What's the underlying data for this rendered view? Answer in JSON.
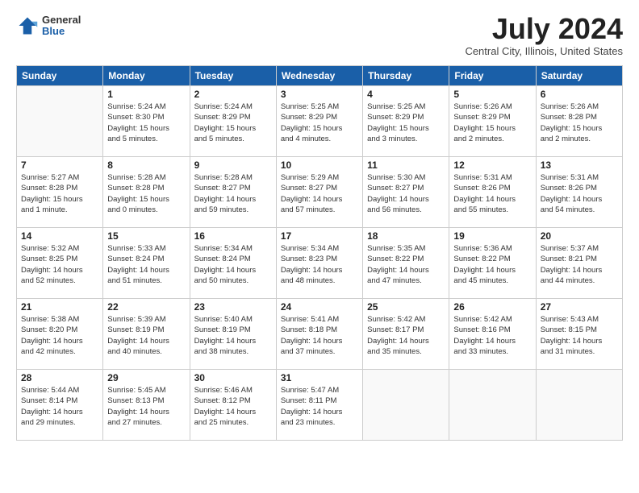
{
  "logo": {
    "general": "General",
    "blue": "Blue"
  },
  "title": "July 2024",
  "location": "Central City, Illinois, United States",
  "headers": [
    "Sunday",
    "Monday",
    "Tuesday",
    "Wednesday",
    "Thursday",
    "Friday",
    "Saturday"
  ],
  "weeks": [
    [
      {
        "day": "",
        "info": ""
      },
      {
        "day": "1",
        "info": "Sunrise: 5:24 AM\nSunset: 8:30 PM\nDaylight: 15 hours\nand 5 minutes."
      },
      {
        "day": "2",
        "info": "Sunrise: 5:24 AM\nSunset: 8:29 PM\nDaylight: 15 hours\nand 5 minutes."
      },
      {
        "day": "3",
        "info": "Sunrise: 5:25 AM\nSunset: 8:29 PM\nDaylight: 15 hours\nand 4 minutes."
      },
      {
        "day": "4",
        "info": "Sunrise: 5:25 AM\nSunset: 8:29 PM\nDaylight: 15 hours\nand 3 minutes."
      },
      {
        "day": "5",
        "info": "Sunrise: 5:26 AM\nSunset: 8:29 PM\nDaylight: 15 hours\nand 2 minutes."
      },
      {
        "day": "6",
        "info": "Sunrise: 5:26 AM\nSunset: 8:28 PM\nDaylight: 15 hours\nand 2 minutes."
      }
    ],
    [
      {
        "day": "7",
        "info": "Sunrise: 5:27 AM\nSunset: 8:28 PM\nDaylight: 15 hours\nand 1 minute."
      },
      {
        "day": "8",
        "info": "Sunrise: 5:28 AM\nSunset: 8:28 PM\nDaylight: 15 hours\nand 0 minutes."
      },
      {
        "day": "9",
        "info": "Sunrise: 5:28 AM\nSunset: 8:27 PM\nDaylight: 14 hours\nand 59 minutes."
      },
      {
        "day": "10",
        "info": "Sunrise: 5:29 AM\nSunset: 8:27 PM\nDaylight: 14 hours\nand 57 minutes."
      },
      {
        "day": "11",
        "info": "Sunrise: 5:30 AM\nSunset: 8:27 PM\nDaylight: 14 hours\nand 56 minutes."
      },
      {
        "day": "12",
        "info": "Sunrise: 5:31 AM\nSunset: 8:26 PM\nDaylight: 14 hours\nand 55 minutes."
      },
      {
        "day": "13",
        "info": "Sunrise: 5:31 AM\nSunset: 8:26 PM\nDaylight: 14 hours\nand 54 minutes."
      }
    ],
    [
      {
        "day": "14",
        "info": "Sunrise: 5:32 AM\nSunset: 8:25 PM\nDaylight: 14 hours\nand 52 minutes."
      },
      {
        "day": "15",
        "info": "Sunrise: 5:33 AM\nSunset: 8:24 PM\nDaylight: 14 hours\nand 51 minutes."
      },
      {
        "day": "16",
        "info": "Sunrise: 5:34 AM\nSunset: 8:24 PM\nDaylight: 14 hours\nand 50 minutes."
      },
      {
        "day": "17",
        "info": "Sunrise: 5:34 AM\nSunset: 8:23 PM\nDaylight: 14 hours\nand 48 minutes."
      },
      {
        "day": "18",
        "info": "Sunrise: 5:35 AM\nSunset: 8:22 PM\nDaylight: 14 hours\nand 47 minutes."
      },
      {
        "day": "19",
        "info": "Sunrise: 5:36 AM\nSunset: 8:22 PM\nDaylight: 14 hours\nand 45 minutes."
      },
      {
        "day": "20",
        "info": "Sunrise: 5:37 AM\nSunset: 8:21 PM\nDaylight: 14 hours\nand 44 minutes."
      }
    ],
    [
      {
        "day": "21",
        "info": "Sunrise: 5:38 AM\nSunset: 8:20 PM\nDaylight: 14 hours\nand 42 minutes."
      },
      {
        "day": "22",
        "info": "Sunrise: 5:39 AM\nSunset: 8:19 PM\nDaylight: 14 hours\nand 40 minutes."
      },
      {
        "day": "23",
        "info": "Sunrise: 5:40 AM\nSunset: 8:19 PM\nDaylight: 14 hours\nand 38 minutes."
      },
      {
        "day": "24",
        "info": "Sunrise: 5:41 AM\nSunset: 8:18 PM\nDaylight: 14 hours\nand 37 minutes."
      },
      {
        "day": "25",
        "info": "Sunrise: 5:42 AM\nSunset: 8:17 PM\nDaylight: 14 hours\nand 35 minutes."
      },
      {
        "day": "26",
        "info": "Sunrise: 5:42 AM\nSunset: 8:16 PM\nDaylight: 14 hours\nand 33 minutes."
      },
      {
        "day": "27",
        "info": "Sunrise: 5:43 AM\nSunset: 8:15 PM\nDaylight: 14 hours\nand 31 minutes."
      }
    ],
    [
      {
        "day": "28",
        "info": "Sunrise: 5:44 AM\nSunset: 8:14 PM\nDaylight: 14 hours\nand 29 minutes."
      },
      {
        "day": "29",
        "info": "Sunrise: 5:45 AM\nSunset: 8:13 PM\nDaylight: 14 hours\nand 27 minutes."
      },
      {
        "day": "30",
        "info": "Sunrise: 5:46 AM\nSunset: 8:12 PM\nDaylight: 14 hours\nand 25 minutes."
      },
      {
        "day": "31",
        "info": "Sunrise: 5:47 AM\nSunset: 8:11 PM\nDaylight: 14 hours\nand 23 minutes."
      },
      {
        "day": "",
        "info": ""
      },
      {
        "day": "",
        "info": ""
      },
      {
        "day": "",
        "info": ""
      }
    ]
  ]
}
